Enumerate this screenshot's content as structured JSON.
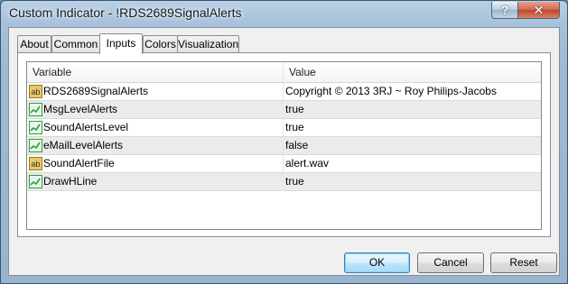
{
  "window": {
    "title": "Custom Indicator - !RDS2689SignalAlerts",
    "help_glyph": "?",
    "close_glyph": "✕"
  },
  "tabs": [
    {
      "label": "About",
      "active": false
    },
    {
      "label": "Common",
      "active": false
    },
    {
      "label": "Inputs",
      "active": true
    },
    {
      "label": "Colors",
      "active": false
    },
    {
      "label": "Visualization",
      "active": false
    }
  ],
  "grid": {
    "columns": [
      "Variable",
      "Value"
    ],
    "rows": [
      {
        "icon": "string-ab-icon",
        "name": "RDS2689SignalAlerts",
        "value": "Copyright © 2013 3RJ ~ Roy Philips-Jacobs"
      },
      {
        "icon": "boolean-chart-icon",
        "name": "MsgLevelAlerts",
        "value": "true"
      },
      {
        "icon": "boolean-chart-icon",
        "name": "SoundAlertsLevel",
        "value": "true"
      },
      {
        "icon": "boolean-chart-icon",
        "name": "eMailLevelAlerts",
        "value": "false"
      },
      {
        "icon": "string-ab-icon",
        "name": "SoundAlertFile",
        "value": "alert.wav"
      },
      {
        "icon": "boolean-chart-icon",
        "name": "DrawHLine",
        "value": "true"
      }
    ]
  },
  "buttons": {
    "ok": "OK",
    "cancel": "Cancel",
    "reset": "Reset"
  },
  "colors": {
    "string_icon": "#e8c86a",
    "boolean_icon": "#2f9e3a",
    "ok_border": "#3c7fb1",
    "close_button": "#c0452b"
  }
}
